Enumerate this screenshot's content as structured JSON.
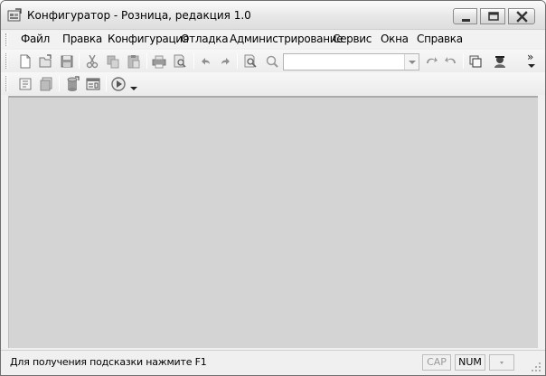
{
  "window": {
    "title": "Конфигуратор - Розница, редакция 1.0"
  },
  "menu": {
    "items": [
      {
        "key": "file",
        "label": "Файл"
      },
      {
        "key": "edit",
        "label": "Правка"
      },
      {
        "key": "config",
        "label": "Конфигурация"
      },
      {
        "key": "debug",
        "label": "Отладка"
      },
      {
        "key": "admin",
        "label": "Администрирование"
      },
      {
        "key": "service",
        "label": "Сервис"
      },
      {
        "key": "windows",
        "label": "Окна"
      },
      {
        "key": "help",
        "label": "Справка"
      }
    ]
  },
  "toolbar": {
    "search_value": "",
    "overflow_label": "»"
  },
  "status": {
    "hint": "Для получения подсказки нажмите F1",
    "cap": "CAP",
    "num": "NUM"
  },
  "colors": {
    "client_bg": "#d4d4d4",
    "frame_bg": "#f0f0f0",
    "close_accent": "#c0392b"
  }
}
